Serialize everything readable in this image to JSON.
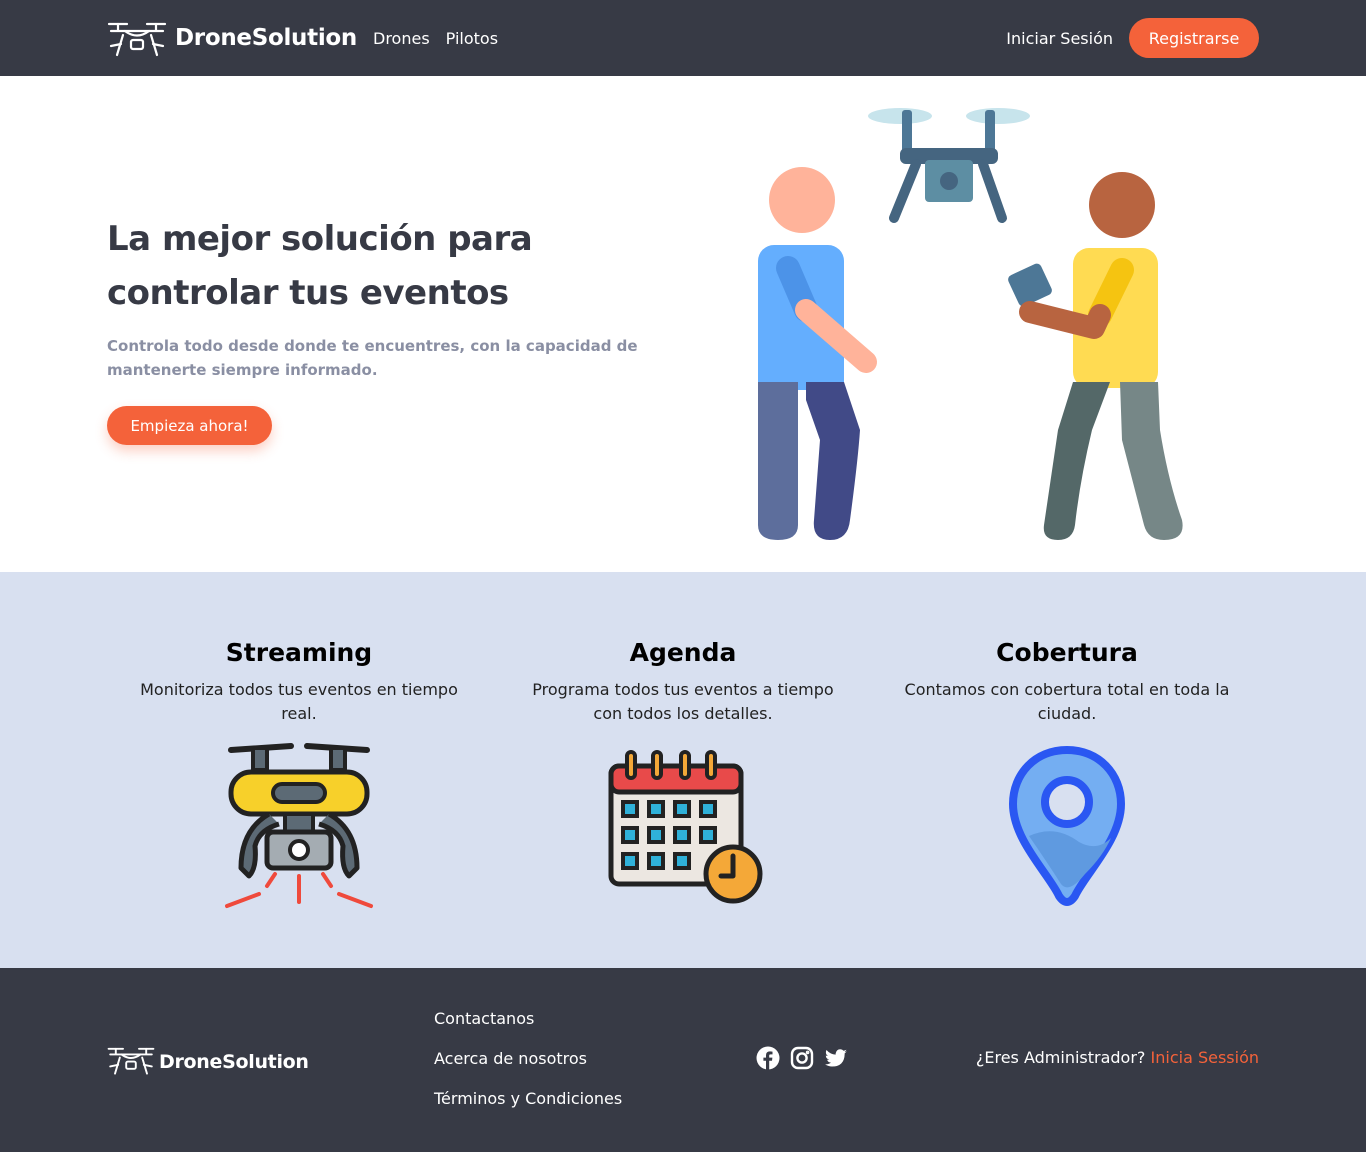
{
  "navbar": {
    "brand": "DroneSolution",
    "links": [
      "Drones",
      "Pilotos"
    ],
    "login": "Iniciar Sesión",
    "register": "Registrarse"
  },
  "hero": {
    "title": "La mejor solución para controlar tus eventos",
    "subtitle": "Controla todo desde donde te encuentres, con la capacidad de mantenerte siempre informado.",
    "cta": "Empieza ahora!"
  },
  "features": [
    {
      "title": "Streaming",
      "desc": "Monitoriza todos tus eventos en tiempo real.",
      "icon": "drone-camera-icon"
    },
    {
      "title": "Agenda",
      "desc": "Programa todos tus eventos a tiempo con todos los detalles.",
      "icon": "calendar-clock-icon"
    },
    {
      "title": "Cobertura",
      "desc": "Contamos con cobertura total en toda la ciudad.",
      "icon": "location-pin-icon"
    }
  ],
  "footer": {
    "brand": "DroneSolution",
    "links": [
      "Contactanos",
      "Acerca de nosotros",
      "Términos y Condiciones"
    ],
    "socials": [
      "facebook-icon",
      "instagram-icon",
      "twitter-icon"
    ],
    "admin_question": "¿Eres Administrador?",
    "admin_link": "Inicia Sessión"
  },
  "colors": {
    "accent": "#f4623a",
    "dark": "#373a45",
    "features_bg": "#d8e0f0"
  }
}
